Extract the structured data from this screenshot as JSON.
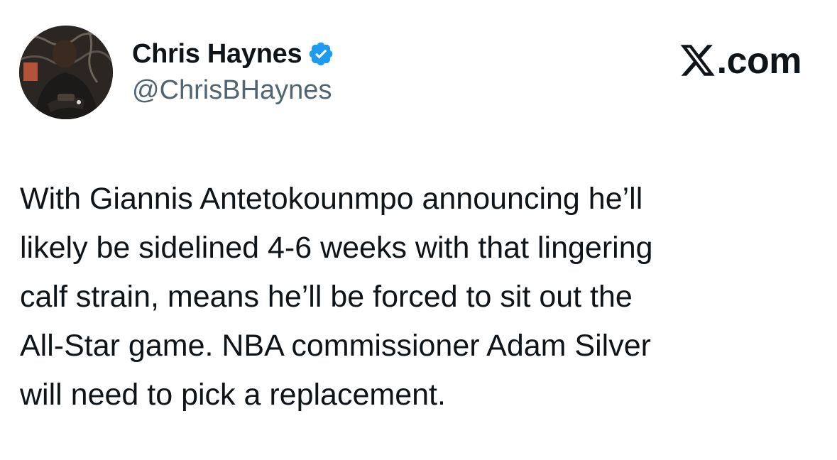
{
  "author": {
    "display_name": "Chris Haynes",
    "handle": "@ChrisBHaynes",
    "verified": true,
    "verified_color": "#1d9bf0",
    "avatar_icon": "profile-photo"
  },
  "brand": {
    "logo_icon": "x-logo-icon",
    "suffix": ".com"
  },
  "tweet": {
    "text": "With Giannis Antetokounmpo announcing he’ll\nlikely be sidelined 4-6 weeks with that lingering\ncalf strain, means he’ll be forced to sit out the\nAll-Star game. NBA commissioner Adam Silver\nwill need to pick a replacement."
  },
  "colors": {
    "text_primary": "#0f1419",
    "text_secondary": "#536471",
    "background": "#ffffff"
  }
}
